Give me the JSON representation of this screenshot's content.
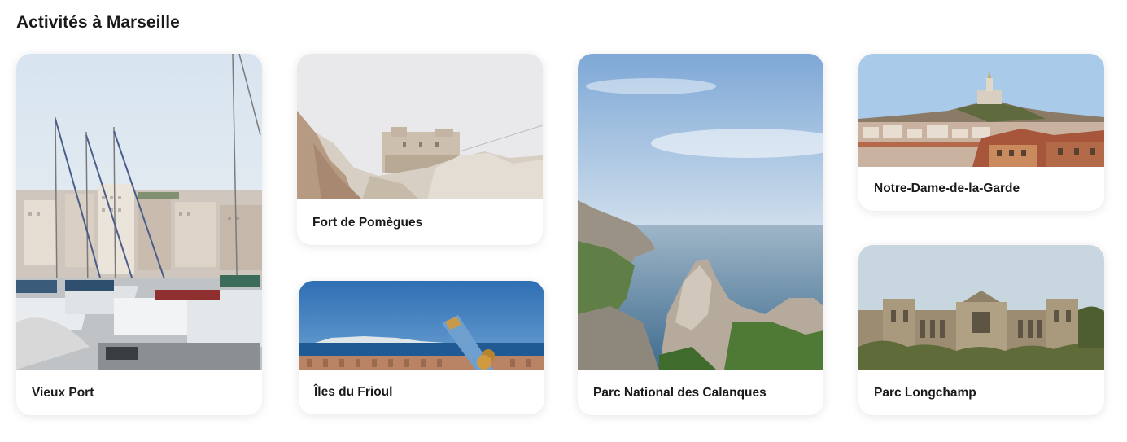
{
  "section": {
    "title": "Activités à Marseille"
  },
  "activities": [
    {
      "label": "Vieux Port",
      "image": "harbor-sailboats-photo"
    },
    {
      "label": "Fort de Pomègues",
      "image": "fort-on-rocks-photo"
    },
    {
      "label": "Îles du Frioul",
      "image": "island-telescope-photo"
    },
    {
      "label": "Parc National des Calanques",
      "image": "calanques-cliffs-sea-photo"
    },
    {
      "label": "Notre-Dame-de-la-Garde",
      "image": "basilica-hill-city-photo"
    },
    {
      "label": "Parc Longchamp",
      "image": "palais-longchamp-photo"
    }
  ]
}
